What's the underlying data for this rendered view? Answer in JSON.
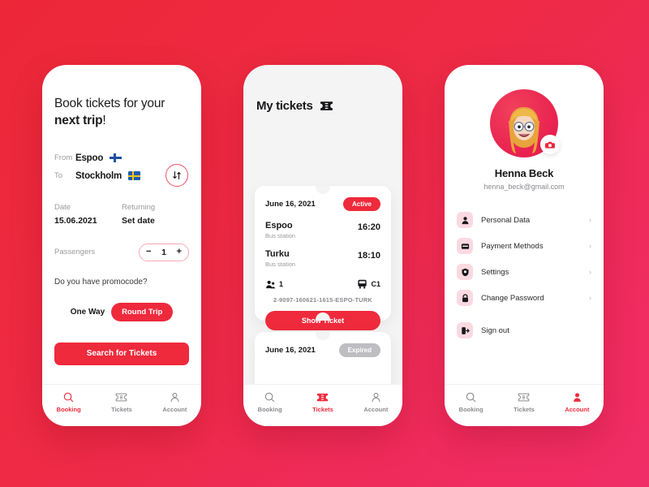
{
  "theme": {
    "accent": "#EE2A3C",
    "bg_start": "#ED2738",
    "bg_end": "#F02D66",
    "muted": "#9A9A9F"
  },
  "booking": {
    "heading_line1": "Book tickets for your",
    "heading_line2_bold": "next trip",
    "heading_line2_rest": "!",
    "from_label": "From",
    "from_city": "Espoo",
    "from_flag": "flag-finland-icon",
    "to_label": "To",
    "to_city": "Stockholm",
    "to_flag": "flag-sweden-icon",
    "swap_icon": "swap-vertical-icon",
    "date_label": "Date",
    "date_value": "15.06.2021",
    "returning_label": "Returning",
    "returning_value": "Set date",
    "passengers_label": "Passengers",
    "passengers_minus": "−",
    "passengers_count": "1",
    "passengers_plus": "+",
    "promo_text": "Do you have promocode?",
    "one_way_label": "One Way",
    "round_trip_label": "Round Trip",
    "search_button": "Search for Tickets"
  },
  "tickets": {
    "title": "My tickets",
    "title_icon": "ticket-icon",
    "items": [
      {
        "date": "June 16, 2021",
        "status": "Active",
        "status_type": "active",
        "origin_city": "Espoo",
        "origin_sub": "Bus station",
        "origin_time": "16:20",
        "dest_city": "Turku",
        "dest_sub": "Bus station",
        "dest_time": "18:10",
        "passengers_icon": "passengers-icon",
        "passengers_count": "1",
        "bus_icon": "bus-icon",
        "bus_code": "C1",
        "code": "2-9097-160621-1615-ESPO-TURK",
        "action": "Show Ticket"
      },
      {
        "date": "June 16, 2021",
        "status": "Expired",
        "status_type": "expired"
      }
    ]
  },
  "account": {
    "avatar_icon": "user-avatar",
    "camera_badge_icon": "camera-icon",
    "name": "Henna Beck",
    "email": "henna_beck@gmail.com",
    "menu": [
      {
        "label": "Personal Data",
        "icon": "person-icon",
        "chevron": "›"
      },
      {
        "label": "Payment Methods",
        "icon": "wallet-icon",
        "chevron": "›"
      },
      {
        "label": "Settings",
        "icon": "shield-icon",
        "chevron": "›"
      },
      {
        "label": "Change Password",
        "icon": "lock-icon",
        "chevron": "›"
      },
      {
        "label": "Sign out",
        "icon": "signout-icon",
        "chevron": ""
      }
    ]
  },
  "tabbar": {
    "booking": "Booking",
    "tickets": "Tickets",
    "account": "Account"
  }
}
